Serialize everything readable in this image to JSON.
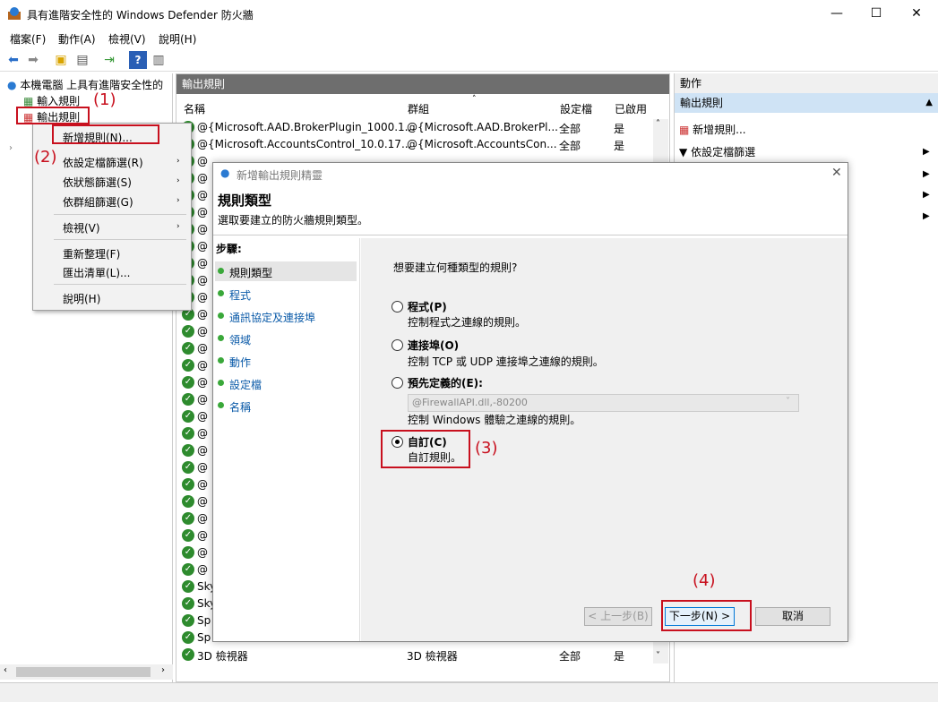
{
  "window": {
    "title": "具有進階安全性的 Windows Defender 防火牆",
    "minimize": "—",
    "maximize": "☐",
    "close": "✕"
  },
  "menu": [
    "檔案(F)",
    "動作(A)",
    "檢視(V)",
    "說明(H)"
  ],
  "tree": {
    "root": "本機電腦 上具有進階安全性的",
    "inbound": "輸入規則",
    "outbound": "輸出規則"
  },
  "center": {
    "header": "輸出規則",
    "columns": [
      "名稱",
      "群組",
      "設定檔",
      "已啟用"
    ],
    "rows": [
      {
        "name": "@{Microsoft.AAD.BrokerPlugin_1000.1...",
        "group": "@{Microsoft.AAD.BrokerPl...",
        "profile": "全部",
        "enabled": "是"
      },
      {
        "name": "@{Microsoft.AccountsControl_10.0.17...",
        "group": "@{Microsoft.AccountsCon...",
        "profile": "全部",
        "enabled": "是"
      },
      {
        "name": "Sky",
        "group": "",
        "profile": "",
        "enabled": ""
      },
      {
        "name": "Sky",
        "group": "",
        "profile": "",
        "enabled": ""
      },
      {
        "name": "Sp",
        "group": "",
        "profile": "",
        "enabled": ""
      },
      {
        "name": "Sp",
        "group": "",
        "profile": "",
        "enabled": ""
      },
      {
        "name": "3D 檢視器",
        "group": "3D 檢視器",
        "profile": "全部",
        "enabled": "是"
      }
    ],
    "partial_row": "@"
  },
  "actions": {
    "header": "動作",
    "sub": "輸出規則",
    "items": [
      "新增規則...",
      "依設定檔篩選"
    ]
  },
  "context_menu": {
    "items": [
      "新增規則(N)...",
      "依設定檔篩選(R)",
      "依狀態篩選(S)",
      "依群組篩選(G)",
      "檢視(V)",
      "重新整理(F)",
      "匯出清單(L)...",
      "說明(H)"
    ]
  },
  "dialog": {
    "title": "新增輸出規則精靈",
    "heading": "規則類型",
    "subheading": "選取要建立的防火牆規則類型。",
    "steps_label": "步驟:",
    "steps": [
      "規則類型",
      "程式",
      "通訊協定及連接埠",
      "領域",
      "動作",
      "設定檔",
      "名稱"
    ],
    "question": "想要建立何種類型的規則?",
    "options": [
      {
        "label": "程式(P)",
        "desc": "控制程式之連線的規則。"
      },
      {
        "label": "連接埠(O)",
        "desc": "控制 TCP 或 UDP 連接埠之連線的規則。"
      },
      {
        "label": "預先定義的(E):",
        "desc": "控制 Windows 體驗之連線的規則。"
      },
      {
        "label": "自訂(C)",
        "desc": "自訂規則。"
      }
    ],
    "predefined_value": "@FirewallAPI.dll,-80200",
    "back": "< 上一步(B)",
    "next": "下一步(N) >",
    "cancel": "取消"
  },
  "annotations": [
    "(1)",
    "(2)",
    "(3)",
    "(4)"
  ],
  "colors": {
    "annotation": "#c8101e",
    "step_link": "#0a5aa8",
    "check": "#2e8b2e"
  }
}
